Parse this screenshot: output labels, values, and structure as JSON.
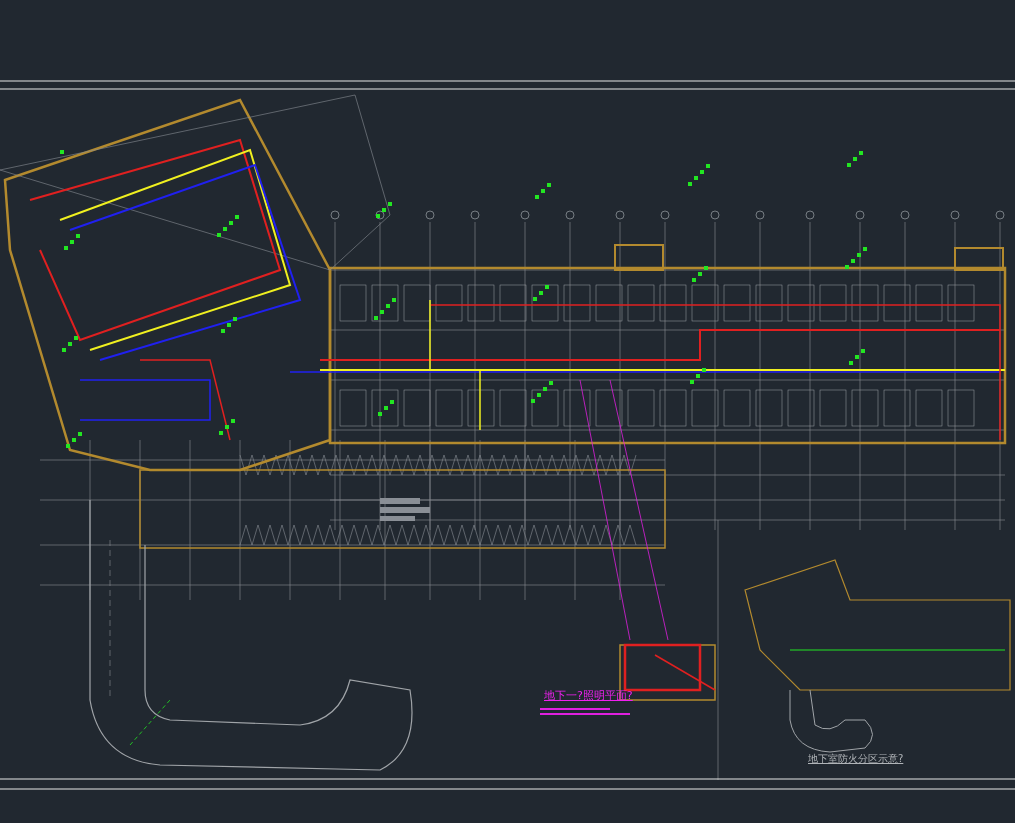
{
  "drawing": {
    "title": "地下一?照明平面?"
  },
  "key_plan": {
    "title": "地下室防火分区示意?"
  }
}
